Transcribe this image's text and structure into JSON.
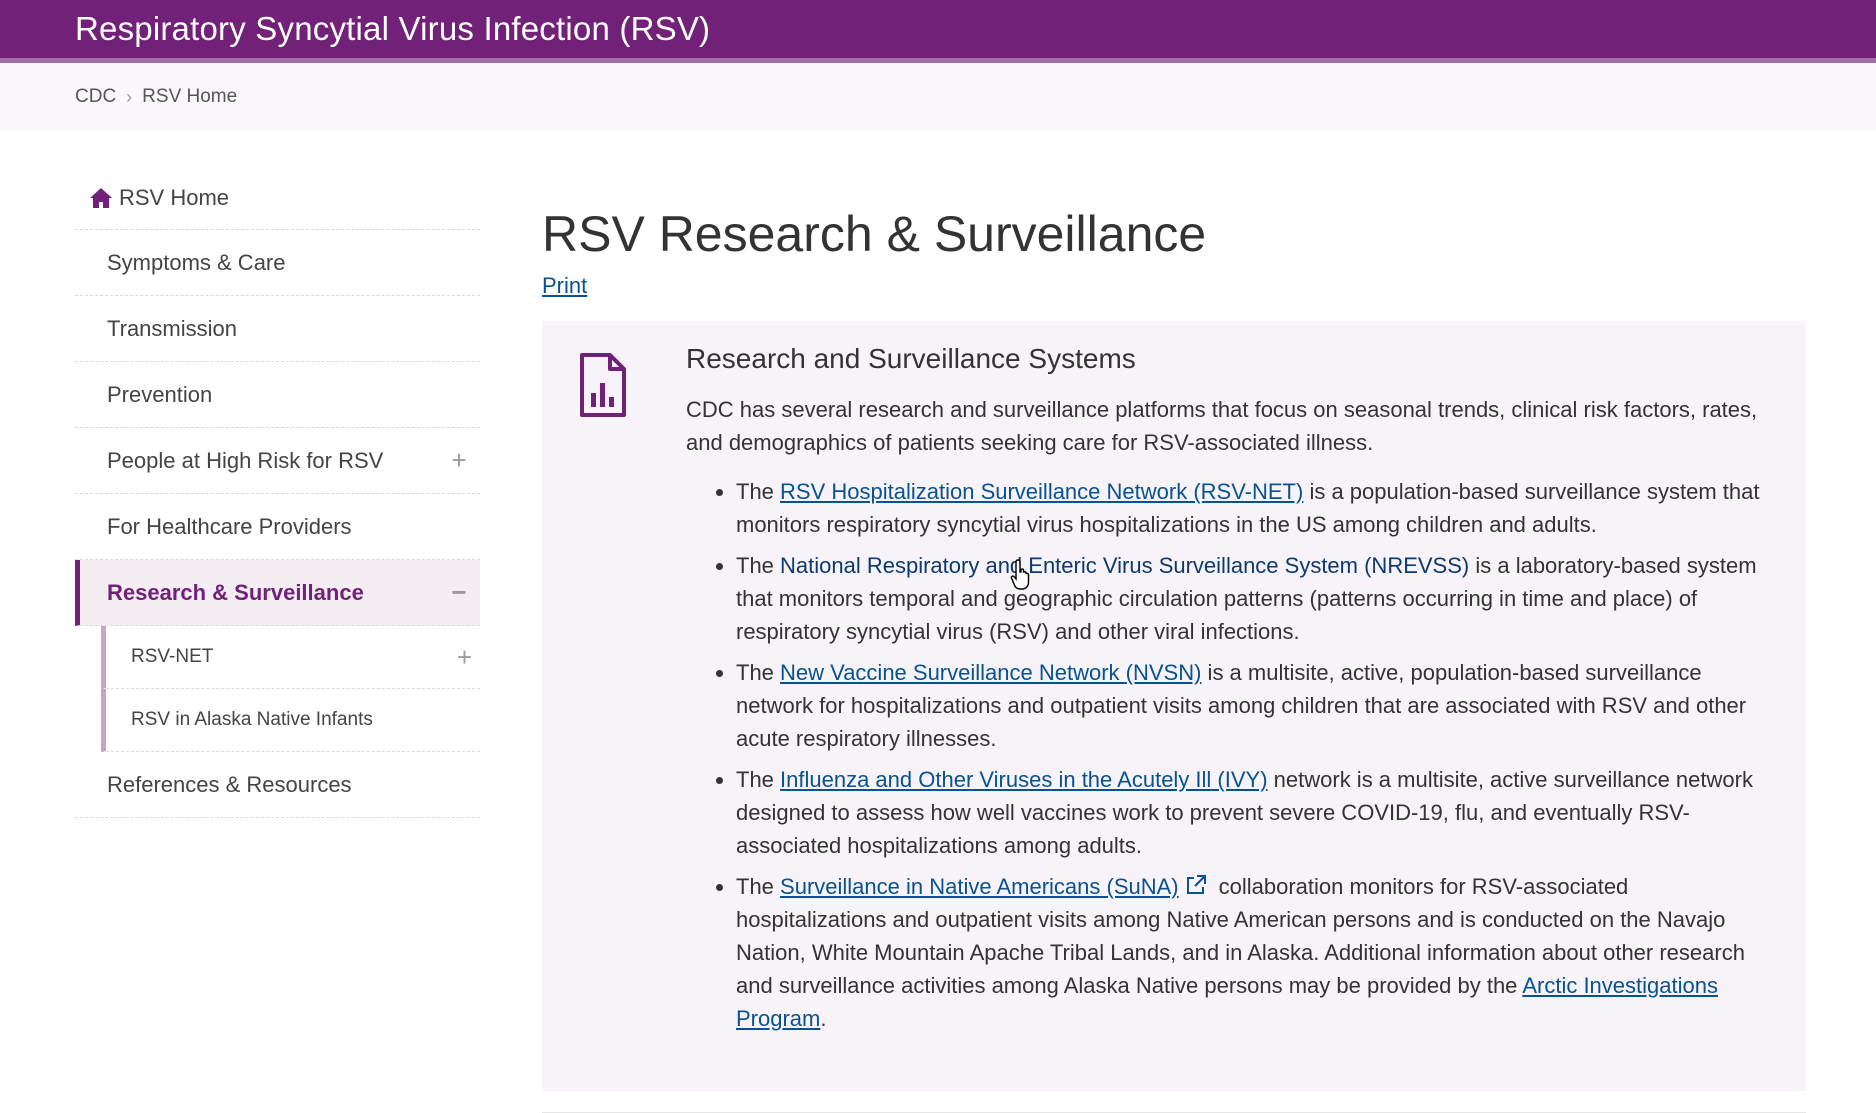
{
  "header": {
    "title": "Respiratory Syncytial Virus Infection (RSV)"
  },
  "breadcrumb": {
    "items": [
      "CDC",
      "RSV Home"
    ]
  },
  "sidebar": {
    "home": "RSV Home",
    "items": [
      {
        "label": "Symptoms & Care"
      },
      {
        "label": "Transmission"
      },
      {
        "label": "Prevention"
      },
      {
        "label": "People at High Risk for RSV",
        "toggle": "+"
      },
      {
        "label": "For Healthcare Providers"
      },
      {
        "label": "Research & Surveillance",
        "toggle": "−"
      }
    ],
    "subitems": [
      {
        "label": "RSV-NET",
        "toggle": "+"
      },
      {
        "label": "RSV in Alaska Native Infants"
      }
    ],
    "last": {
      "label": "References & Resources"
    }
  },
  "main": {
    "title": "RSV Research & Surveillance",
    "print": "Print",
    "box": {
      "heading": "Research and Surveillance Systems",
      "intro": "CDC has several research and surveillance platforms that focus on seasonal trends, clinical risk factors, rates, and demographics of patients seeking care for RSV-associated illness.",
      "items": [
        {
          "prefix": "The ",
          "link": "RSV Hospitalization Surveillance Network (RSV-NET)",
          "rest": " is a population-based surveillance system that monitors respiratory syncytial virus hospitalizations in the US among children and adults."
        },
        {
          "prefix": "The ",
          "link": "National Respiratory and Enteric Virus Surveillance System (NREVSS)",
          "rest": " is a laboratory-based system that monitors temporal and geographic circulation patterns (patterns occurring in time and place) of respiratory syncytial virus (RSV) and other viral infections."
        },
        {
          "prefix": "The ",
          "link": "New Vaccine Surveillance Network (NVSN)",
          "rest": " is a multisite, active, population-based surveillance network for hospitalizations and outpatient visits among children that are associated with RSV and other acute respiratory illnesses."
        },
        {
          "prefix": "The ",
          "link": "Influenza and Other Viruses in the Acutely Ill (IVY)",
          "rest": " network is a multisite, active surveillance network designed to assess how well vaccines work to prevent severe COVID-19, flu, and eventually RSV-associated hospitalizations among adults."
        },
        {
          "prefix": "The ",
          "link": "Surveillance in Native Americans (SuNA)",
          "rest": "collaboration monitors for RSV-associated hospitalizations and outpatient visits among Native American persons and is conducted on the Navajo Nation, White Mountain Apache Tribal Lands, and in Alaska. Additional information about other research and surveillance activities among Alaska Native persons may be provided by the ",
          "link2": "Arctic Investigations Program",
          "end": "."
        }
      ]
    }
  },
  "colors": {
    "brand": "#712177",
    "link": "#075290",
    "box_bg": "#f8f3f8"
  },
  "icons": {
    "home": "home-icon",
    "document": "document-chart-icon",
    "external": "external-link-icon"
  }
}
